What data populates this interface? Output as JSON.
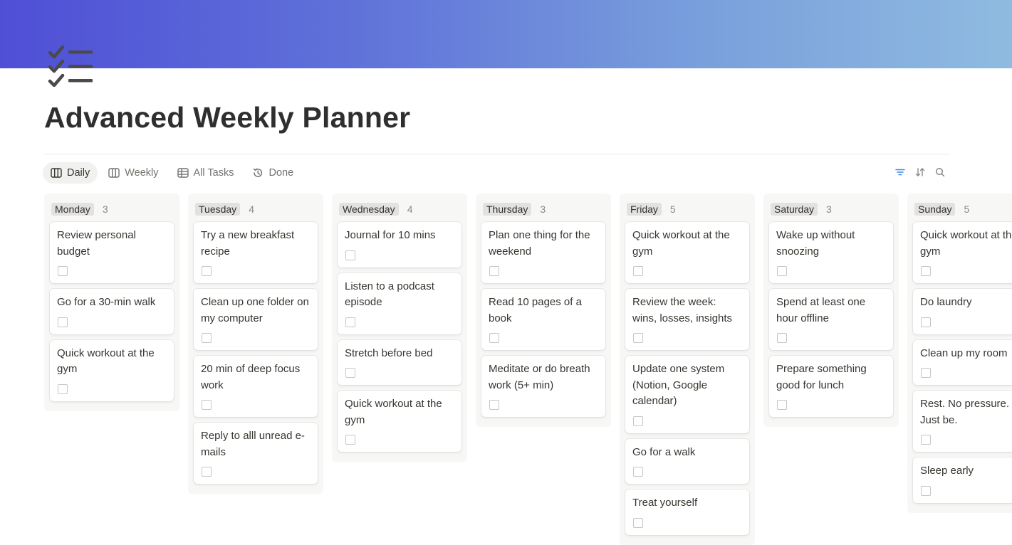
{
  "page": {
    "title": "Advanced Weekly Planner",
    "icon": "checklist-icon"
  },
  "colors": {
    "cover_start": "#4f4fd6",
    "cover_end": "#8fbbe0",
    "column_bg": "#f7f7f5",
    "label_bg": "#e3e2e0"
  },
  "views": {
    "tabs": [
      {
        "label": "Daily",
        "icon": "board-icon",
        "active": true
      },
      {
        "label": "Weekly",
        "icon": "board-icon",
        "active": false
      },
      {
        "label": "All Tasks",
        "icon": "table-icon",
        "active": false
      },
      {
        "label": "Done",
        "icon": "history-icon",
        "active": false
      }
    ],
    "tools": [
      "filter-icon",
      "sort-icon",
      "search-icon"
    ]
  },
  "board": {
    "columns": [
      {
        "name": "Monday",
        "count": "3",
        "cards": [
          "Review personal budget",
          "Go for a 30-min walk",
          "Quick workout at the gym"
        ]
      },
      {
        "name": "Tuesday",
        "count": "4",
        "cards": [
          "Try a new breakfast recipe",
          "Clean up one folder on my computer",
          "20 min of deep focus work",
          "Reply to alll unread e-mails"
        ]
      },
      {
        "name": "Wednesday",
        "count": "4",
        "cards": [
          "Journal for 10 mins",
          "Listen to a podcast episode",
          "Stretch before bed",
          "Quick workout at the gym"
        ]
      },
      {
        "name": "Thursday",
        "count": "3",
        "cards": [
          "Plan one thing for the weekend",
          "Read 10 pages of a book",
          "Meditate or do breath work (5+ min)"
        ]
      },
      {
        "name": "Friday",
        "count": "5",
        "cards": [
          "Quick workout at the gym",
          "Review the week: wins, losses, insights",
          "Update one system (Notion, Google calendar)",
          "Go for a walk",
          "Treat yourself"
        ]
      },
      {
        "name": "Saturday",
        "count": "3",
        "cards": [
          "Wake up without snoozing",
          "Spend at least one hour offline",
          "Prepare something good for lunch"
        ]
      },
      {
        "name": "Sunday",
        "count": "5",
        "cards": [
          "Quick workout at the gym",
          "Do laundry",
          "Clean up my room",
          "Rest. No pressure. Just be.",
          "Sleep early"
        ]
      }
    ]
  }
}
